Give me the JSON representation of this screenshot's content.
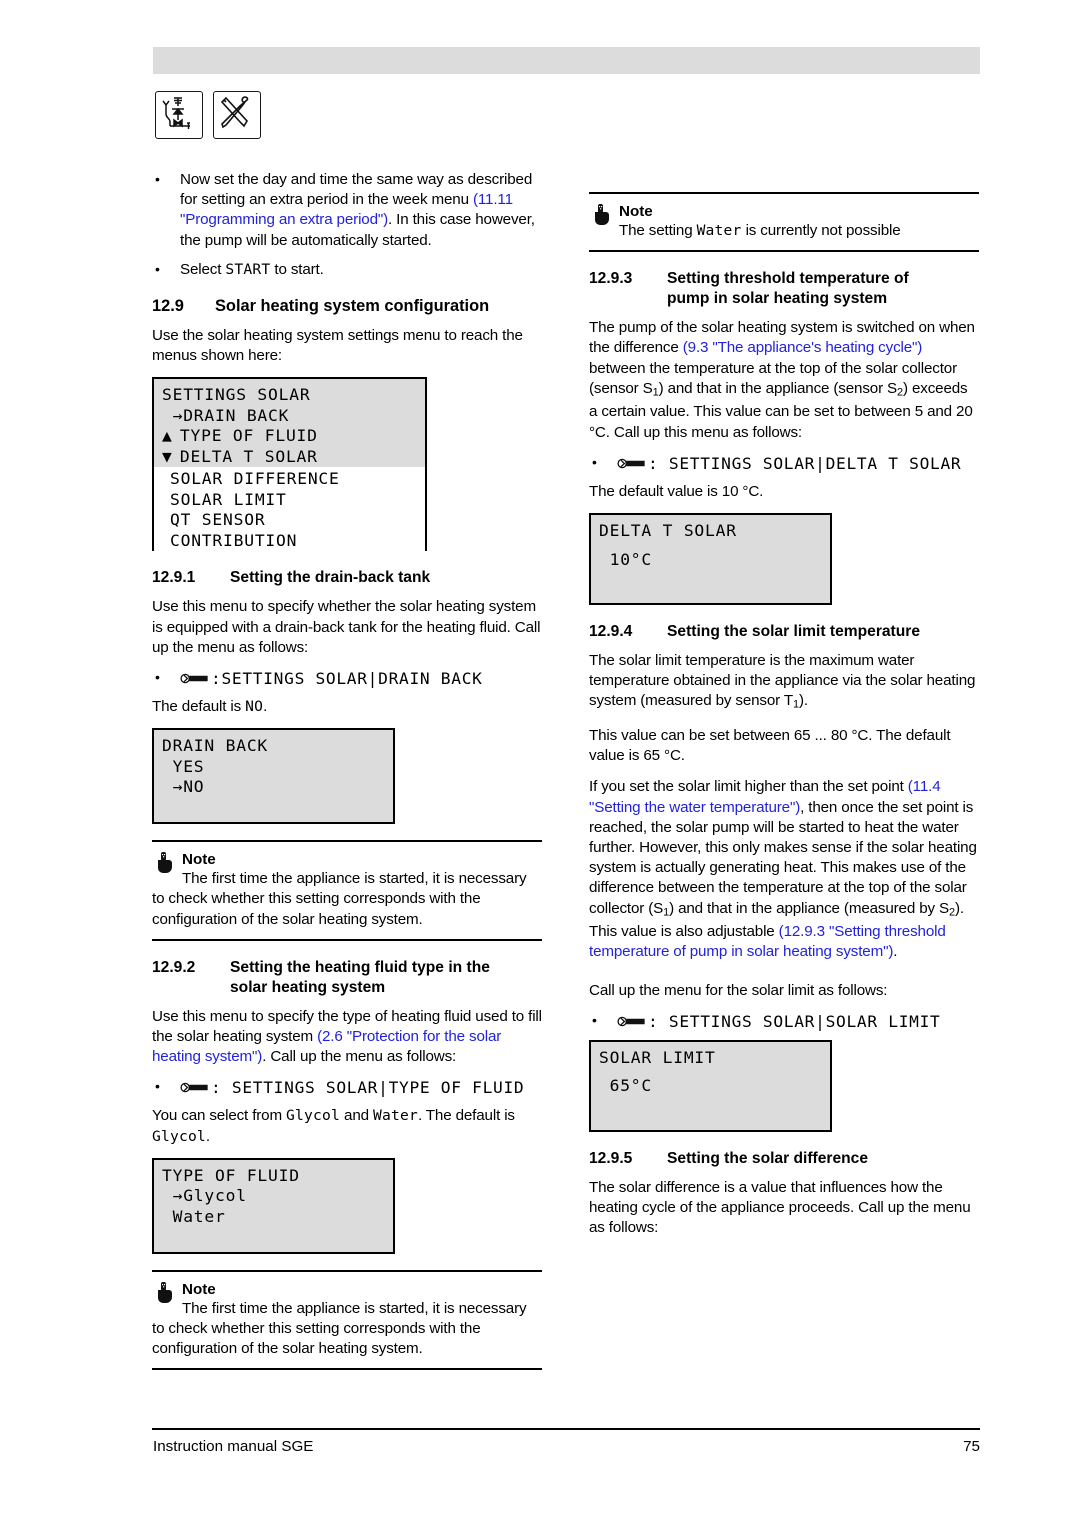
{
  "header": {
    "icons": [
      "hydraulic-valve-schematic-icon",
      "crossed-tools-icon"
    ]
  },
  "left_column": {
    "bullets": [
      {
        "pre": "Now set the day and time the same way as described for setting an extra period in the  week menu ",
        "link": "(11.11 \"Programming an extra period\")",
        "post": ". In this case however, the pump will be automatically started."
      },
      {
        "pre": "Select ",
        "device": "START",
        "post": " to start."
      }
    ],
    "section_12_9": {
      "number": "12.9",
      "title": "Solar heating system configuration",
      "intro": "Use the solar heating system settings menu to reach the menus shown here:"
    },
    "lcd_settings_solar": {
      "highlight_rows": [
        "SETTINGS SOLAR",
        " →DRAIN BACK",
        "TYPE OF FLUID",
        "DELTA T SOLAR"
      ],
      "indicator_up": "▲",
      "indicator_down": "▼",
      "plain_rows": [
        "SOLAR DIFFERENCE",
        "SOLAR LIMIT",
        "QT SENSOR",
        "CONTRIBUTION"
      ]
    },
    "section_12_9_1": {
      "number": "12.9.1",
      "title": "Setting the drain-back tank",
      "para": "Use this menu to specify whether the solar heating system is equipped with a drain-back tank for the heating fluid. Call up the menu as follows:",
      "menu_path": ":SETTINGS SOLAR|DRAIN BACK",
      "default_pre": "The default is ",
      "default_value": "NO",
      "default_post": "."
    },
    "lcd_drain_back": {
      "rows": [
        "DRAIN BACK",
        " YES",
        " →NO"
      ]
    },
    "note_1": {
      "title": "Note",
      "text": "The first time the appliance is started, it is necessary to check whether this setting corresponds with the configuration of the solar heating system."
    },
    "section_12_9_2": {
      "number": "12.9.2",
      "title_line1": "Setting the heating fluid type in the",
      "title_line2": "solar heating system",
      "para_pre": "Use this menu to specify the type of heating fluid used to fill the solar heating system ",
      "para_link": "(2.6 \"Protection for the solar heating system\")",
      "para_post": ".  Call up the menu as follows:",
      "menu_path": ": SETTINGS SOLAR|TYPE OF FLUID",
      "select_pre": "You can select from ",
      "select_a": "Glycol",
      "select_mid": " and ",
      "select_b": "Water",
      "select_post": ". The default is ",
      "select_default": "Glycol",
      "select_end": "."
    },
    "lcd_type_of_fluid": {
      "rows": [
        "TYPE OF FLUID",
        " →Glycol",
        " Water"
      ]
    },
    "note_2": {
      "title": "Note",
      "text": "The first time the appliance is started, it is necessary to check whether this setting corresponds with the configuration of the solar heating system."
    }
  },
  "right_column": {
    "note_water": {
      "title": "Note",
      "text_pre": "The setting ",
      "device": "Water",
      "text_post": " is currently not possible"
    },
    "section_12_9_3": {
      "number": "12.9.3",
      "title_line1": "Setting threshold temperature of",
      "title_line2": "pump in solar heating system",
      "para_pre": "The pump of the solar heating system is switched on when the difference ",
      "para_link": "(9.3 \"The appliance's heating cycle\")",
      "para_post": " between the temperature at the top of the solar collector (sensor S",
      "para_post2": ") and that in the appliance (sensor S",
      "para_post3": ") exceeds a certain value. This value can be set to between 5 and 20 °C. Call up this menu as follows:",
      "sensor_1": "1",
      "sensor_2": "2",
      "menu_path": ": SETTINGS SOLAR|DELTA T SOLAR",
      "default": "The default value is 10 °C."
    },
    "lcd_delta_t": {
      "title": "DELTA T SOLAR",
      "value": " 10°C"
    },
    "section_12_9_4": {
      "number": "12.9.4",
      "title": "Setting the solar limit temperature",
      "para1_pre": "The solar limit temperature is the maximum water temperature obtained in the appliance via the solar heating system (measured by sensor T",
      "para1_sub": "1",
      "para1_post": ").",
      "para2": "This value can be set between 65 ... 80 °C. The default value is 65 °C.",
      "para3_pre": "If you set the solar limit higher than the set point ",
      "para3_link": "(11.4 \"Setting the water temperature\")",
      "para3_mid": ", then once the set point is reached, the solar pump will be started to heat the water further. However, this only makes sense if the solar heating system is actually generating heat. This makes use of the difference between the temperature at the top of the solar collector (S",
      "para3_sub1": "1",
      "para3_mid2": ") and that in the appliance (measured by S",
      "para3_sub2": "2",
      "para3_mid3": "). This value is also adjustable ",
      "para3_link2": "(12.9.3 \"Setting threshold temperature of pump in solar heating system\")",
      "para3_end": ".",
      "call_up": "Call up the menu for the solar limit as follows:",
      "menu_path": ": SETTINGS SOLAR|SOLAR LIMIT"
    },
    "lcd_solar_limit": {
      "title": "SOLAR LIMIT",
      "value": " 65°C"
    },
    "section_12_9_5": {
      "number": "12.9.5",
      "title": "Setting the solar difference",
      "para": "The solar difference is a value that influences how the heating cycle of the appliance proceeds. Call up the menu as follows:"
    }
  },
  "footer": {
    "left": "Instruction manual SGE",
    "page": "75"
  },
  "colors": {
    "link": "#2222dd",
    "lcd_background": "#dcdcdc",
    "header_bar": "#dcdcdc"
  }
}
